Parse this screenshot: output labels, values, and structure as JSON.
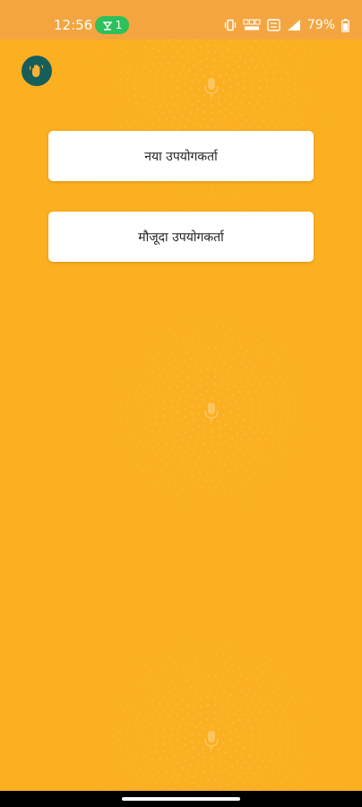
{
  "status_bar": {
    "time": "12:56",
    "hotspot_count": "1",
    "battery_percent": "79%",
    "icons": [
      "vibrate-icon",
      "data-speed-icon",
      "volte-icon",
      "signal-icon",
      "battery-icon"
    ]
  },
  "app": {
    "logo_icon": "hand-wave-icon",
    "background_color": "#fbb021",
    "status_bar_color": "#f4a540"
  },
  "buttons": {
    "new_user": "नया उपयोगकर्ता",
    "existing_user": "मौजूदा उपयोगकर्ता"
  }
}
